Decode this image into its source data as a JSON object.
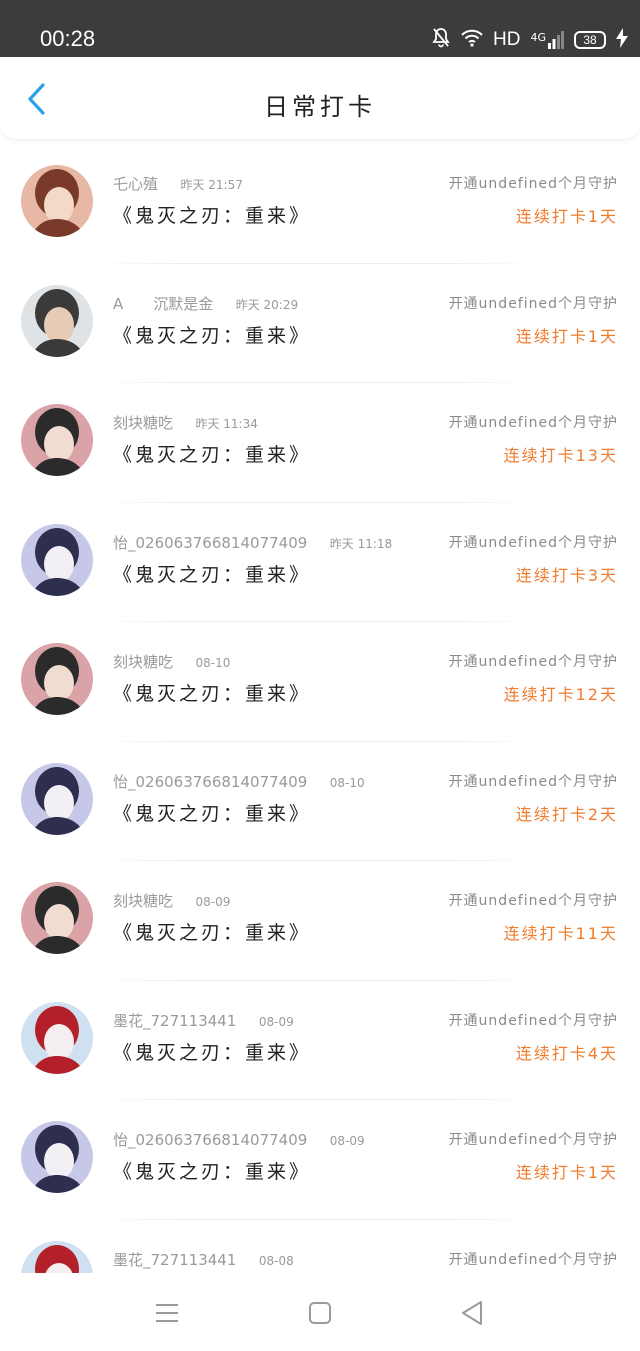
{
  "status_bar": {
    "time": "00:28",
    "network": "HD",
    "cell": "4G",
    "battery": "38"
  },
  "header": {
    "title": "日常打卡"
  },
  "items": [
    {
      "user": "乇心殖",
      "time": "昨天 21:57",
      "work": "《鬼灭之刃：重来》",
      "guard": "开通undefined个月守护",
      "streak": "连续打卡1天",
      "avatar_colors": [
        "#e8b8a6",
        "#7a3a2a",
        "#f3d9c8"
      ]
    },
    {
      "user": "A　　沉默是金",
      "time": "昨天 20:29",
      "work": "《鬼灭之刃：重来》",
      "guard": "开通undefined个月守护",
      "streak": "连续打卡1天",
      "avatar_colors": [
        "#dfe3e6",
        "#3a3a3a",
        "#e6cbb6"
      ]
    },
    {
      "user": "刻块糖吃",
      "time": "昨天 11:34",
      "work": "《鬼灭之刃：重来》",
      "guard": "开通undefined个月守护",
      "streak": "连续打卡13天",
      "avatar_colors": [
        "#d9a3a8",
        "#2b2b2b",
        "#f0dcd0"
      ]
    },
    {
      "user": "怡_026063766814077409",
      "time": "昨天 11:18",
      "work": "《鬼灭之刃：重来》",
      "guard": "开通undefined个月守护",
      "streak": "连续打卡3天",
      "avatar_colors": [
        "#c7c8e8",
        "#2e2f4e",
        "#f3f0f5"
      ]
    },
    {
      "user": "刻块糖吃",
      "time": "08-10",
      "work": "《鬼灭之刃：重来》",
      "guard": "开通undefined个月守护",
      "streak": "连续打卡12天",
      "avatar_colors": [
        "#d9a3a8",
        "#2b2b2b",
        "#f0dcd0"
      ]
    },
    {
      "user": "怡_026063766814077409",
      "time": "08-10",
      "work": "《鬼灭之刃：重来》",
      "guard": "开通undefined个月守护",
      "streak": "连续打卡2天",
      "avatar_colors": [
        "#c7c8e8",
        "#2e2f4e",
        "#f3f0f5"
      ]
    },
    {
      "user": "刻块糖吃",
      "time": "08-09",
      "work": "《鬼灭之刃：重来》",
      "guard": "开通undefined个月守护",
      "streak": "连续打卡11天",
      "avatar_colors": [
        "#d9a3a8",
        "#2b2b2b",
        "#f0dcd0"
      ]
    },
    {
      "user": "墨花_727113441",
      "time": "08-09",
      "work": "《鬼灭之刃：重来》",
      "guard": "开通undefined个月守护",
      "streak": "连续打卡4天",
      "avatar_colors": [
        "#cfe0f0",
        "#b3202a",
        "#f4eef0"
      ]
    },
    {
      "user": "怡_026063766814077409",
      "time": "08-09",
      "work": "《鬼灭之刃：重来》",
      "guard": "开通undefined个月守护",
      "streak": "连续打卡1天",
      "avatar_colors": [
        "#c7c8e8",
        "#2e2f4e",
        "#f3f0f5"
      ]
    },
    {
      "user": "墨花_727113441",
      "time": "08-08",
      "work": "",
      "guard": "开通undefined个月守护",
      "streak": "",
      "avatar_colors": [
        "#cfe0f0",
        "#b3202a",
        "#f4eef0"
      ]
    }
  ],
  "colors": {
    "accent_back": "#2aa1ea",
    "streak": "#f07c2e",
    "status_bar": "#3c3c3c"
  },
  "nav": {
    "icons": [
      "menu-icon",
      "home-square-icon",
      "back-triangle-icon"
    ]
  }
}
